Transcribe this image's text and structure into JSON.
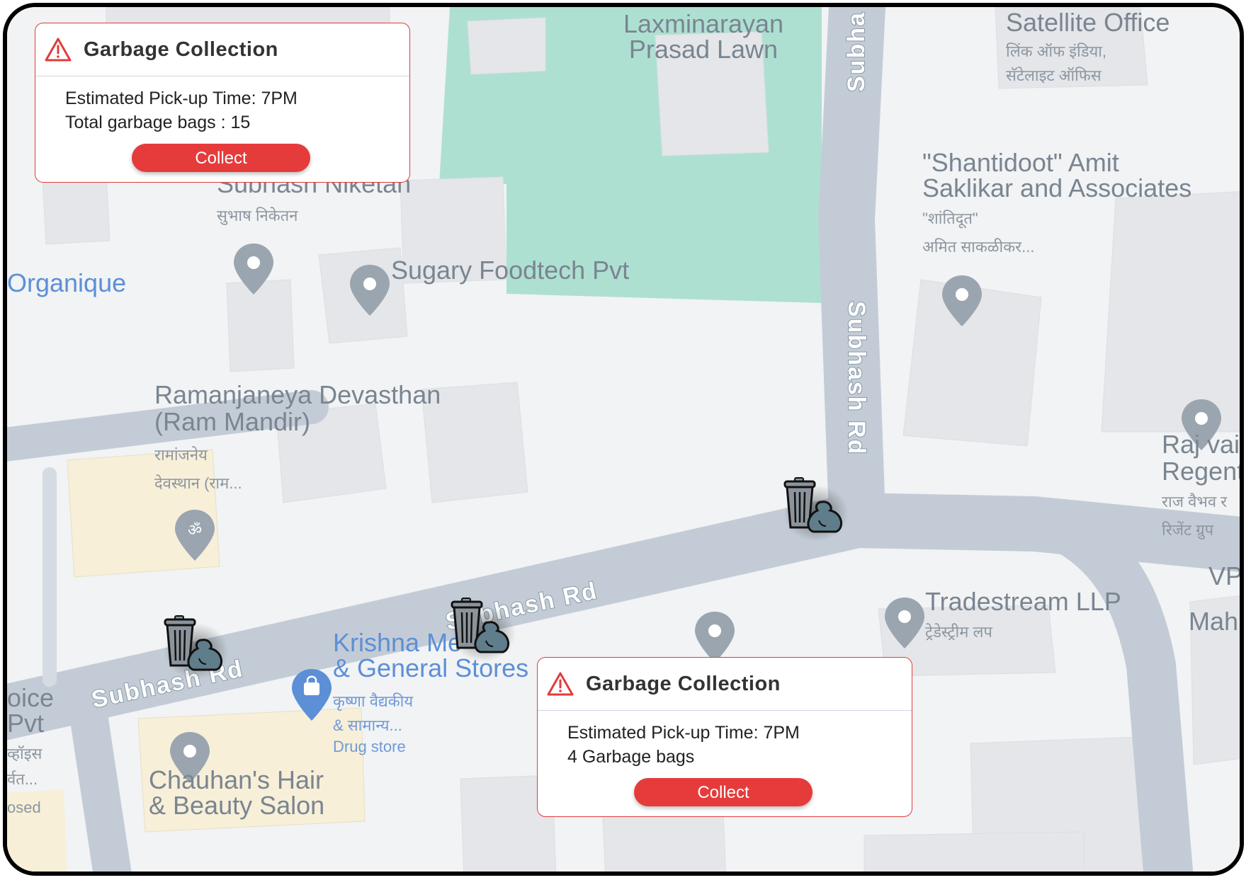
{
  "map": {
    "places": {
      "laxminarayan_1": "Laxminarayan",
      "laxminarayan_2": "Prasad Lawn",
      "satellite_1": "Satellite Office",
      "satellite_2": "लिंक ऑफ इंडिया,",
      "satellite_3": "सॅटेलाइट ऑफिस",
      "shantidoot_1": "\"Shantidoot\" Amit",
      "shantidoot_2": "Saklikar and Associates",
      "shantidoot_3": "\"शांतिदूत\"",
      "shantidoot_4": "अमित साकळीकर...",
      "subhash_niketan_1": "Subhash Niketan",
      "subhash_niketan_2": "सुभाष निकेतन",
      "sugary": "Sugary Foodtech Pvt",
      "organique": "Organique",
      "ramanjaneya_1": "Ramanjaneya Devasthan",
      "ramanjaneya_2": "(Ram Mandir)",
      "ramanjaneya_3": "रामांजनेय",
      "ramanjaneya_4": "देवस्थान (राम...",
      "raj_1": "Raj vai",
      "raj_2": "Regent",
      "raj_3": "राज वैभव र",
      "raj_4": "रिजेंट ग्रुप",
      "vp": "VP",
      "mah": "Mah",
      "tradestream_1": "Tradestream LLP",
      "tradestream_2": "ट्रेडेस्ट्रीम लप",
      "krishna_1": "Krishna Me",
      "krishna_2": "& General Stores",
      "krishna_3": "कृष्णा वैद्यकीय",
      "krishna_4": "& सामान्य...",
      "krishna_5": "Drug store",
      "chauhan_1": "Chauhan's Hair",
      "chauhan_2": "& Beauty Salon",
      "left_1": "oice",
      "left_2": "Pvt",
      "left_3": "व्हॉइस",
      "left_4": "र्वत...",
      "left_5": "osed"
    },
    "roads": {
      "subhash_vertical": "Subhash Rd",
      "subhash_top": "Subha",
      "subhash_main": "Subhash Rd",
      "subhash_left": "Subhash Rd"
    }
  },
  "cards": [
    {
      "title": "Garbage Collection",
      "line1": "Estimated Pick-up Time: 7PM",
      "line2": "Total garbage bags : 15",
      "button": "Collect"
    },
    {
      "title": "Garbage Collection",
      "line1": "Estimated Pick-up Time: 7PM",
      "line2": "4 Garbage bags",
      "button": "Collect"
    }
  ],
  "icons": {
    "warning": "warning-triangle-icon",
    "bin": "garbage-bin-icon",
    "pin": "map-pin-icon"
  },
  "colors": {
    "accent": "#e63b3b",
    "park": "#aee0d2",
    "road": "#c3ccd6",
    "map_bg": "#f1f3f4"
  }
}
